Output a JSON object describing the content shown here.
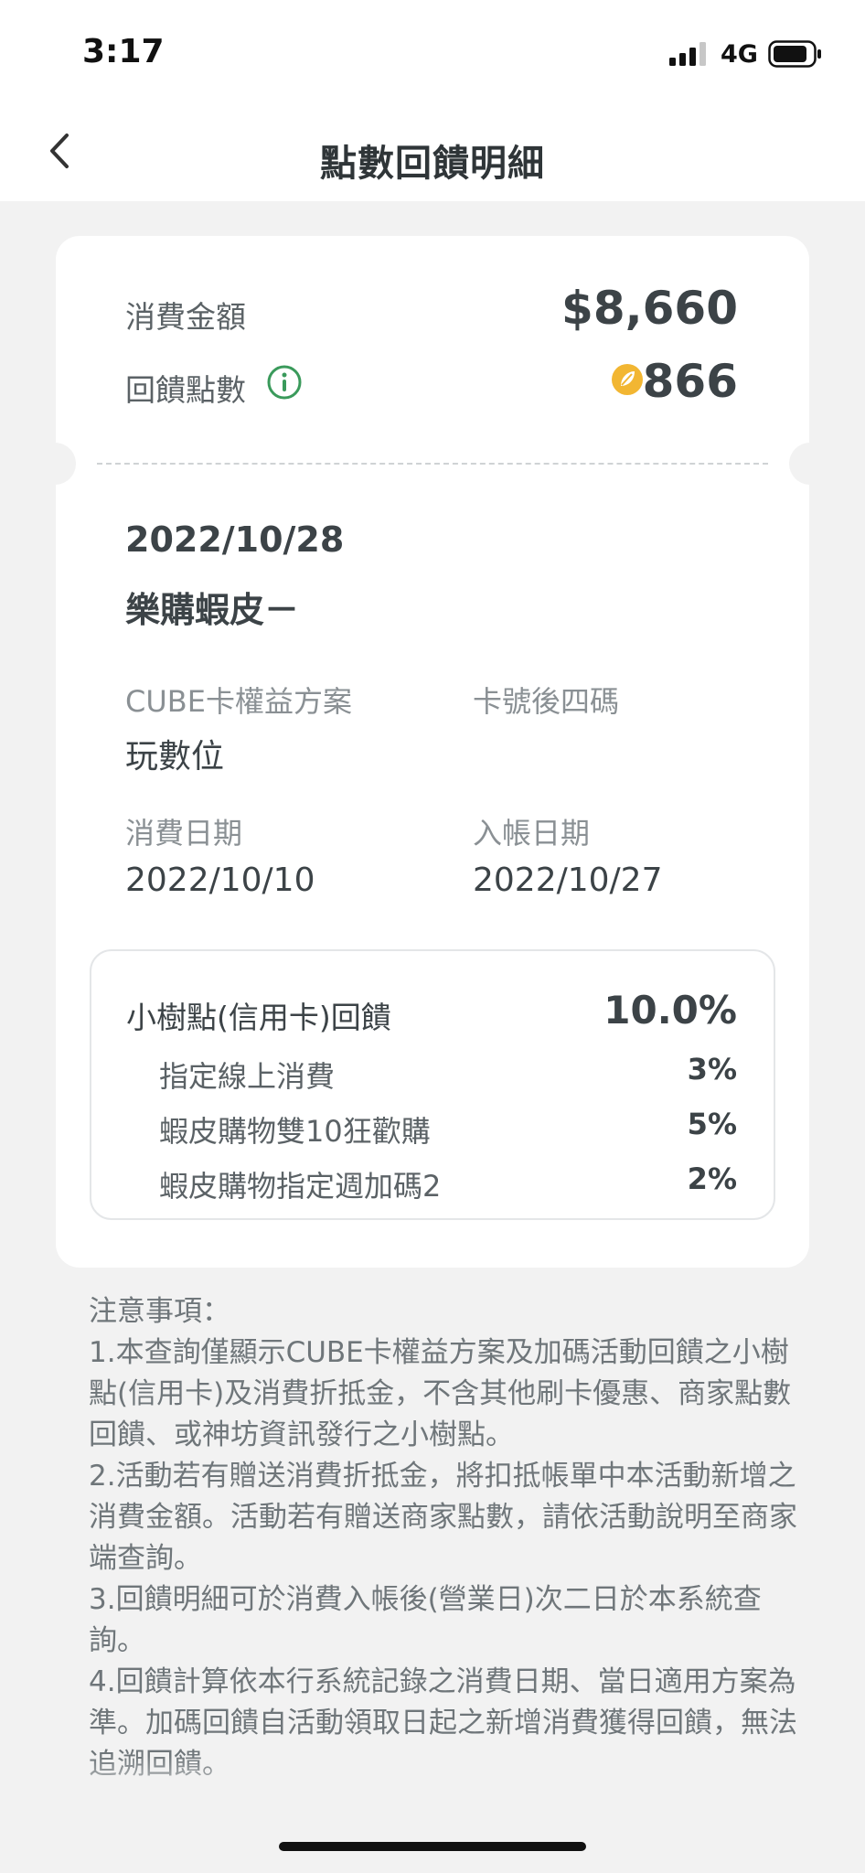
{
  "status_bar": {
    "time": "3:17",
    "network": "4G",
    "signal_icon": "signal-bars-icon",
    "battery_icon": "battery-icon"
  },
  "nav": {
    "title": "點數回饋明細",
    "back_icon": "chevron-left-icon"
  },
  "summary": {
    "spend_label": "消費金額",
    "spend_amount": "$8,660",
    "points_label": "回饋點數",
    "points_value": "866",
    "info_icon": "info-circle-icon",
    "coin_icon": "leaf-coin-icon",
    "accent_green": "#3a9a5b",
    "coin_color": "#f2b632"
  },
  "detail": {
    "date": "2022/10/28",
    "merchant": "樂購蝦皮－",
    "plan_label": "CUBE卡權益方案",
    "plan_value": "玩數位",
    "card_last4_label": "卡號後四碼",
    "card_last4_value": "",
    "spend_date_label": "消費日期",
    "spend_date_value": "2022/10/10",
    "post_date_label": "入帳日期",
    "post_date_value": "2022/10/27"
  },
  "rates": {
    "title": "小樹點(信用卡)回饋",
    "total": "10.0%",
    "items": [
      {
        "label": "指定線上消費",
        "pct": "3%"
      },
      {
        "label": "蝦皮購物雙10狂歡購",
        "pct": "5%"
      },
      {
        "label": "蝦皮購物指定週加碼2",
        "pct": "2%"
      }
    ]
  },
  "notes": {
    "heading": "注意事項：",
    "items": [
      "1.本查詢僅顯示CUBE卡權益方案及加碼活動回饋之小樹點(信用卡)及消費折抵金，不含其他刷卡優惠、商家點數回饋、或神坊資訊發行之小樹點。",
      "2.活動若有贈送消費折抵金，將扣抵帳單中本活動新增之消費金額。活動若有贈送商家點數，請依活動說明至商家端查詢。",
      "3.回饋明細可於消費入帳後(營業日)次二日於本系統查詢。",
      "4.回饋計算依本行系統記錄之消費日期、當日適用方案為準。加碼回饋自活動領取日起之新增消費獲得回饋，無法追溯回饋。"
    ]
  }
}
